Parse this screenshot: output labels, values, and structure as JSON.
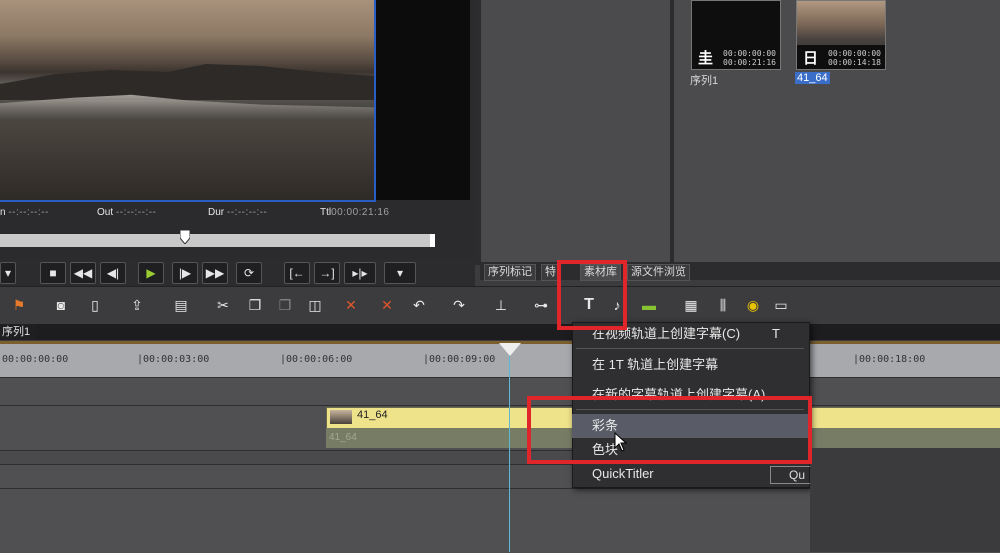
{
  "preview": {
    "in_label": "n",
    "in_value": "--:--:--:--",
    "out_label": "Out",
    "out_value": "--:--:--:--",
    "dur_label": "Dur",
    "dur_value": "--:--:--:--",
    "ttl_label": "Ttl",
    "ttl_value": "00:00:21:16",
    "scrubber_position": 0.42
  },
  "transport": {
    "stop": "■",
    "rewind": "◀◀",
    "step_back": "◀|",
    "play": "▶",
    "step_fwd": "|▶",
    "fast_fwd": "▶▶",
    "loop": "⟳",
    "mark_in": "[←",
    "mark_out": "→]",
    "split": "▸|▸",
    "more": "▾"
  },
  "bin": {
    "items": [
      {
        "label": "序列1",
        "icon_char": "圭",
        "tc_top": "00:00:00:00",
        "tc_bottom": "00:00:21:16",
        "selected": false
      },
      {
        "label": "41_64",
        "icon_char": "日",
        "tc_top": "00:00:00:00",
        "tc_bottom": "00:00:14:18",
        "selected": true
      }
    ]
  },
  "tabs": [
    "序列标记",
    "特",
    "素材库",
    "源文件浏览"
  ],
  "timeline": {
    "sequence_tab": "序列1",
    "ruler_ticks": [
      "00:00:00:00",
      "|00:00:03:00",
      "|00:00:06:00",
      "|00:00:09:00",
      "|00:00:18:00"
    ],
    "clip_name": "41_64",
    "clip_name_audio": "41_64"
  },
  "menu": {
    "items": [
      {
        "label": "在视频轨道上创建字幕(C)",
        "key": "T"
      },
      {
        "label": "在 1T 轨道上创建字幕",
        "key": ""
      },
      {
        "label": "在新的字幕轨道上创建字幕(A)",
        "key": ""
      },
      {
        "label": "彩条",
        "key": ""
      },
      {
        "label": "色块",
        "key": ""
      },
      {
        "label": "QuickTitler",
        "key": ""
      }
    ],
    "extra_right": "Qu"
  },
  "colors": {
    "highlight": "#e0262b",
    "selection": "#595c67",
    "playhead": "#5fb7d6",
    "clip": "#eee28a"
  }
}
